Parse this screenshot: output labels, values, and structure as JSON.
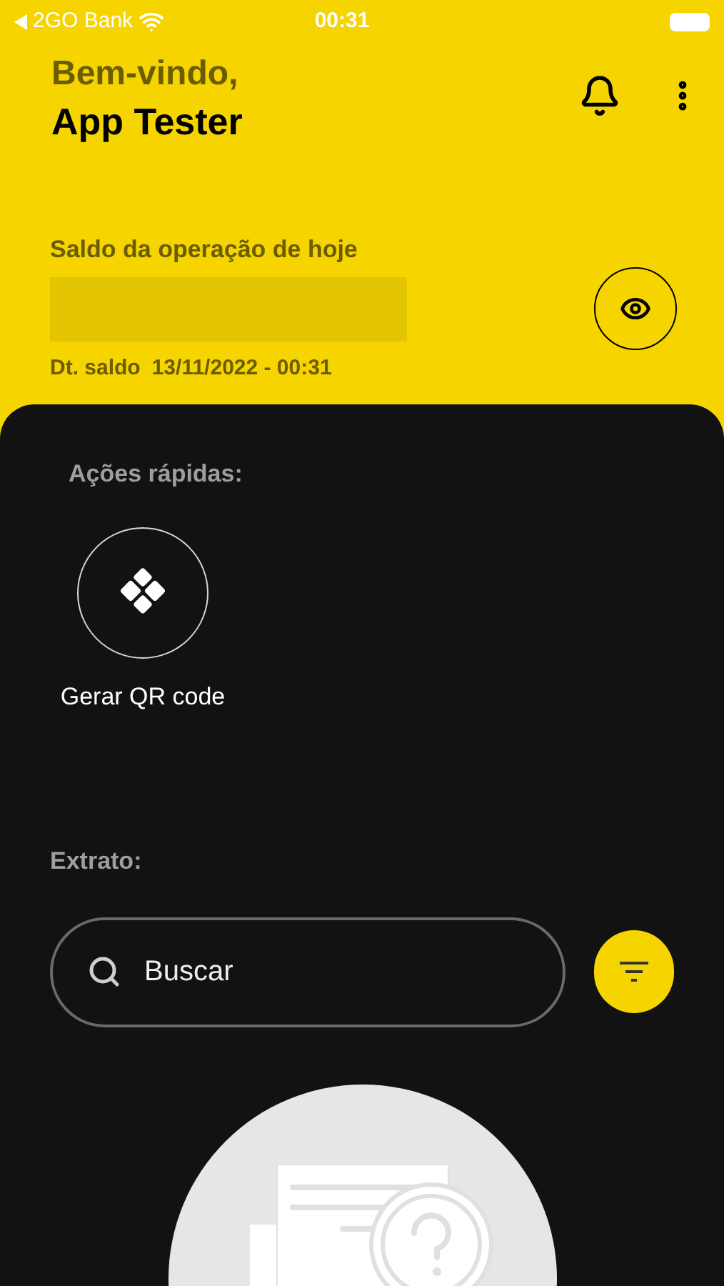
{
  "status_bar": {
    "back_app": "2GO Bank",
    "time": "00:31"
  },
  "header": {
    "greeting": "Bem-vindo,",
    "user_name": "App Tester"
  },
  "balance": {
    "label": "Saldo da operação de hoje",
    "hidden": true,
    "date_label": "Dt. saldo",
    "date_value": "13/11/2022 - 00:31"
  },
  "quick_actions": {
    "title": "Ações rápidas:",
    "items": [
      {
        "label": "Gerar QR code"
      }
    ]
  },
  "statement": {
    "title": "Extrato:",
    "search": {
      "placeholder": "Buscar"
    }
  }
}
